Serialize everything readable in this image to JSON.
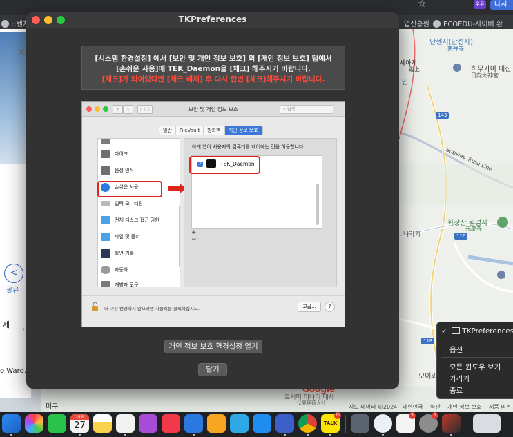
{
  "browser": {
    "bookmarks": [
      "::벤치",
      "업진흥원",
      "ECOEDU-사이버 환"
    ],
    "profile_badge": "우유",
    "top_button": "다시"
  },
  "left_page": {
    "close_glyph": "✕",
    "share_glyph": "<",
    "share_label": "공유",
    "text_je": "제",
    "arrow_glyph": "›",
    "text_ward": "o Ward,"
  },
  "map": {
    "labels": {
      "nanjeji": "난젠지(난선사)",
      "nanjeji_sub": "南禅寺",
      "sekage": "세아게",
      "sekage_sub": "蹴上",
      "hyuga": "히무카이 대신",
      "hyuga_sub": "日向大神宮",
      "in": "인",
      "route143": "143",
      "subway": "Subway Tozai Line",
      "gangsan": "화정산 원경사",
      "gangsan_sub": "元慶寺",
      "route116": "116",
      "route118": "118",
      "kita": "나가기",
      "oiwa": "오이와",
      "bottom_mi": "미구",
      "bottom_jinai": "흐시미 이나리 대사",
      "bottom_jinai_sub": "伏見稲荷大社",
      "google": "Google",
      "footer": [
        "지도 데이터 ©2024",
        "대한민국",
        "약관",
        "개인 정보 보호",
        "제품 의견 보"
      ]
    }
  },
  "dialog": {
    "title": "TKPreferences",
    "notice_line1": "[시스템 환경설정] 에서 [보안 및 개인 정보 보호] 의 [개인 정보 보호] 탭에서",
    "notice_line2": "[손쉬운 사용]에 TEK_Daemon을 [체크] 해주시기 바랍니다.",
    "notice_line3": "[체크]가 되어있다면 [체크 해제] 후 다시 한번 [체크]해주시기 바랍니다.",
    "screenshot": {
      "title": "보안 및 개인 정보 보호",
      "search_placeholder": "검색",
      "grid_glyph": "⋮⋮⋮",
      "back_glyph": "‹",
      "fwd_glyph": "›",
      "tabs": [
        "일반",
        "FileVault",
        "방화벽",
        "개인 정보 보호"
      ],
      "sidebar": [
        "마이크",
        "음성 인식",
        "손쉬운 사용",
        "입력 모니터링",
        "전체 디스크 접근 권한",
        "파일 및 폴더",
        "화면 기록",
        "자동화",
        "개발자 도구"
      ],
      "description": "아래 앱이 사용자의 컴퓨터를 제어하는 것을 허용합니다.",
      "app_name": "TEK_Daemon",
      "plus_minus": "+ −",
      "lock_text": "더 이상 변경하지 않으려면 자물쇠를 클릭하십시오.",
      "advanced": "고급...",
      "help": "?"
    },
    "open_button": "개인 정보 보호 환경설정 열기",
    "close_button": "닫기"
  },
  "context_menu": {
    "checked_item": "TKPreferences",
    "check_glyph": "✓",
    "options": "옵션",
    "show_all": "모든 윈도우 보기",
    "hide": "가리기",
    "quit": "종료"
  },
  "dock": {
    "calendar_month": "10월",
    "calendar_day": "27",
    "talk_label": "TALK",
    "badge_talk": "30",
    "badge_extra": "5",
    "badge_settings": "1"
  },
  "colors": {
    "highlight_red": "#e0241b",
    "notice_red": "#ff4a3d",
    "accent_blue": "#3a77d8"
  }
}
